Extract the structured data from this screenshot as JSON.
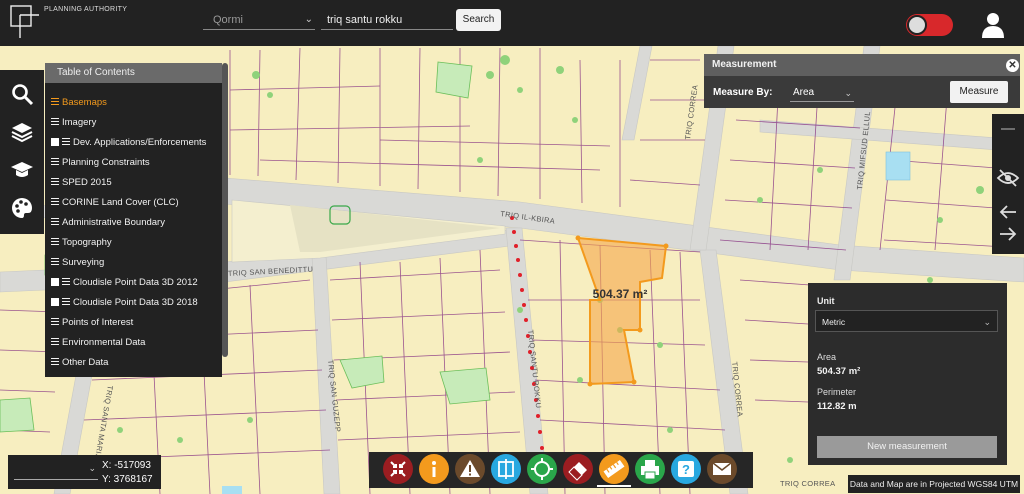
{
  "header": {
    "brand": "PLANNING AUTHORITY",
    "locality_placeholder": "Qormi",
    "street_value": "triq santu rokku",
    "search_label": "Search"
  },
  "toc": {
    "title": "Table of Contents",
    "items": [
      {
        "label": "Basemaps",
        "checkbox": false,
        "active": true
      },
      {
        "label": "Imagery",
        "checkbox": false,
        "active": false
      },
      {
        "label": "Dev. Applications/Enforcements",
        "checkbox": true,
        "active": false
      },
      {
        "label": "Planning Constraints",
        "checkbox": false,
        "active": false
      },
      {
        "label": "SPED 2015",
        "checkbox": false,
        "active": false
      },
      {
        "label": "CORINE Land Cover (CLC)",
        "checkbox": false,
        "active": false
      },
      {
        "label": "Administrative Boundary",
        "checkbox": false,
        "active": false
      },
      {
        "label": "Topography",
        "checkbox": false,
        "active": false
      },
      {
        "label": "Surveying",
        "checkbox": false,
        "active": false
      },
      {
        "label": "Cloudisle Point Data 3D 2012",
        "checkbox": true,
        "active": false
      },
      {
        "label": "Cloudisle Point Data 3D 2018",
        "checkbox": true,
        "active": false
      },
      {
        "label": "Points of Interest",
        "checkbox": false,
        "active": false
      },
      {
        "label": "Environmental Data",
        "checkbox": false,
        "active": false
      },
      {
        "label": "Other Data",
        "checkbox": false,
        "active": false
      }
    ]
  },
  "measurement": {
    "title": "Measurement",
    "measure_by_label": "Measure By:",
    "measure_by_value": "Area",
    "measure_button": "Measure",
    "unit_label": "Unit",
    "unit_value": "Metric",
    "area_label": "Area",
    "area_value": "504.37 m²",
    "perimeter_label": "Perimeter",
    "perimeter_value": "112.82 m",
    "new_button": "New measurement"
  },
  "map": {
    "street_labels": [
      "TRIQ IL-KBIRA",
      "TRIQ SAN BENEDITTU",
      "TRIQ SAN GUZEPP",
      "TRIQ SANTU ROKKU",
      "TRIQ CORREA",
      "TRIQ SANTA MARIJA",
      "TRIQ MIFSUD ELLUL",
      "TRIQ CORREA",
      "TRIQ CORREA"
    ],
    "polygon_label": "504.37 m²"
  },
  "coordinates": {
    "x": "X:  -517093",
    "y": "Y:  3768167"
  },
  "footer_note": "Data and Map are in Projected WGS84 UTM",
  "colors": {
    "topbar": "#222222",
    "map_bg": "#f7eec0",
    "parcel_line": "#8b3a86",
    "road": "#d9d9d6",
    "accent_orange": "#f39a1d",
    "toggle_red": "#d8282b"
  },
  "bottom_tools": [
    {
      "name": "collapse-icon",
      "color": "#9b1d21"
    },
    {
      "name": "info-icon",
      "color": "#f39a1d"
    },
    {
      "name": "warning-icon",
      "color": "#6b4a2b"
    },
    {
      "name": "compare-icon",
      "color": "#28a8e0"
    },
    {
      "name": "locate-icon",
      "color": "#2aa64a"
    },
    {
      "name": "eraser-icon",
      "color": "#9b1d21"
    },
    {
      "name": "ruler-icon",
      "color": "#f39a1d"
    },
    {
      "name": "print-icon",
      "color": "#2aa64a"
    },
    {
      "name": "help-icon",
      "color": "#28a8e0"
    },
    {
      "name": "email-icon",
      "color": "#6b4a2b"
    }
  ]
}
